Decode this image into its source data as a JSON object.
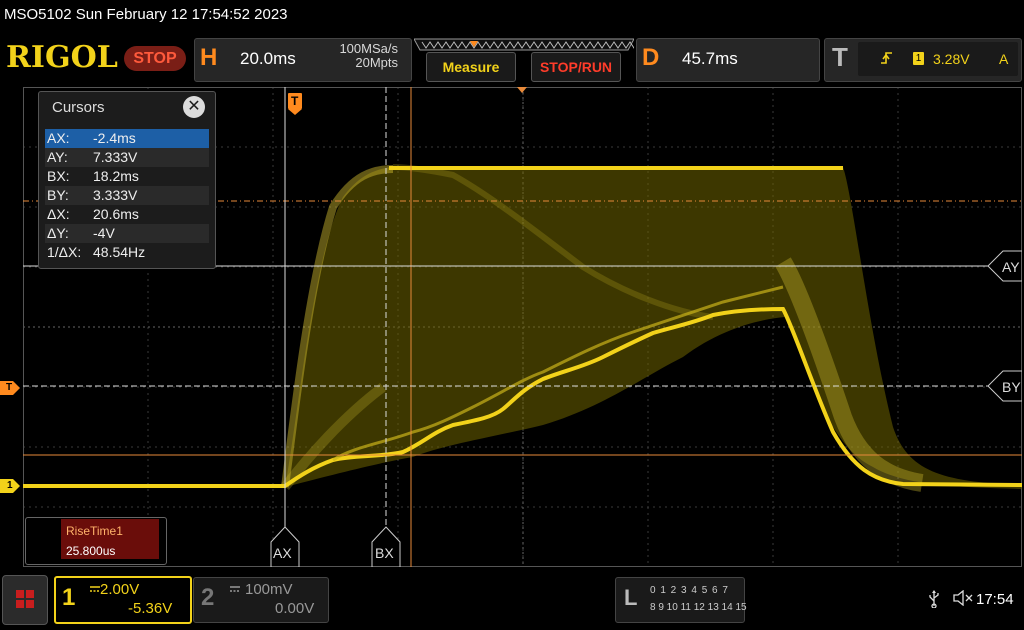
{
  "status_line": "MSO5102  Sun February 12 17:54:52 2023",
  "header": {
    "logo": "RIGOL",
    "run_state": "STOP",
    "horizontal": {
      "key": "H",
      "timebase": "20.0ms",
      "sample_rate": "100MSa/s",
      "memory_depth": "20Mpts"
    },
    "measure_label": "Measure",
    "stoprun_label": "STOP/RUN",
    "delay": {
      "key": "D",
      "value": "45.7ms"
    },
    "trigger": {
      "key": "T",
      "channel": "1",
      "level": "3.28V",
      "mode": "A"
    }
  },
  "cursors": {
    "title": "Cursors",
    "rows": [
      {
        "k": "AX:",
        "v": "-2.4ms"
      },
      {
        "k": "AY:",
        "v": "7.333V"
      },
      {
        "k": "BX:",
        "v": "18.2ms"
      },
      {
        "k": "BY:",
        "v": "3.333V"
      },
      {
        "k": "ΔX:",
        "v": "20.6ms"
      },
      {
        "k": "ΔY:",
        "v": "-4V"
      },
      {
        "k": "1/ΔX:",
        "v": "48.54Hz"
      }
    ]
  },
  "cursor_labels": {
    "ax": "AX",
    "bx": "BX",
    "ay": "AY",
    "by": "BY"
  },
  "markers": {
    "trigger_pos": "T",
    "ch1_ground": "1",
    "trig_level": "T"
  },
  "measurement": {
    "name": "RiseTime1",
    "value": "25.800us"
  },
  "channels": [
    {
      "num": "1",
      "scale": "2.00V",
      "offset": "-5.36V",
      "color": "#f2d21a"
    },
    {
      "num": "2",
      "scale": "100mV",
      "offset": "0.00V",
      "color": "#999999"
    }
  ],
  "logic": {
    "key": "L",
    "row1": "0 1 2 3  4 5 6 7",
    "row2": "8 9 10 11 12 13 14 15"
  },
  "system": {
    "time": "17:54"
  },
  "colors": {
    "accent": "#f2d21a",
    "orange": "#ff8a1e",
    "stop": "#ff3c2a",
    "cursor_orange": "#e88a3a"
  }
}
